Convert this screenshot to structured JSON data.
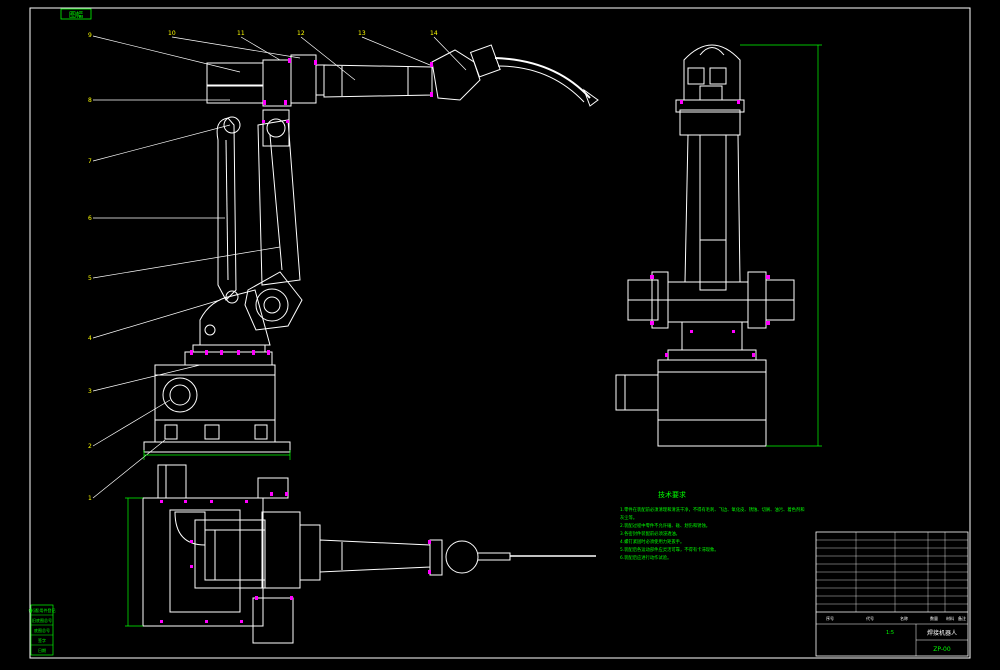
{
  "drawing": {
    "corner_tag": "图幅",
    "balloons": [
      "1",
      "2",
      "3",
      "4",
      "5",
      "6",
      "7",
      "8",
      "9",
      "10",
      "11",
      "12",
      "13",
      "14"
    ],
    "tech_title": "技术要求",
    "tech_lines": [
      "1.零件在装配前必须清理和清洗干净，不得有毛刺、飞边、氧化皮、锈蚀、切屑、油污、着色剂和",
      "灰尘等。",
      "2.装配过程中零件不允许磕、碰、划伤和锈蚀。",
      "3.各密封件装配前必须浸透油。",
      "4.螺钉紧固时必须使用力矩扳手。",
      "5.装配后各运动部件应灵活可靠，不得有卡滞现象。",
      "6.装配后应进行动作试验。"
    ],
    "title_block": {
      "name": "焊接机器人",
      "code": "ZP-00",
      "ratio": "1:5",
      "material": "",
      "cells": [
        "序号",
        "代号",
        "名称",
        "数量",
        "材料",
        "备注"
      ]
    },
    "left_stamp": [
      "借(通)用件登记",
      "旧底图总号",
      "底图总号",
      "签字",
      "日期"
    ]
  },
  "colors": {
    "line": "#ffffff",
    "leader": "#ffffff",
    "dimension": "#00ff00",
    "bolt": "#ff00ff",
    "text_green": "#00ff00",
    "yellow": "#ffff00",
    "frame": "#ffffff"
  }
}
